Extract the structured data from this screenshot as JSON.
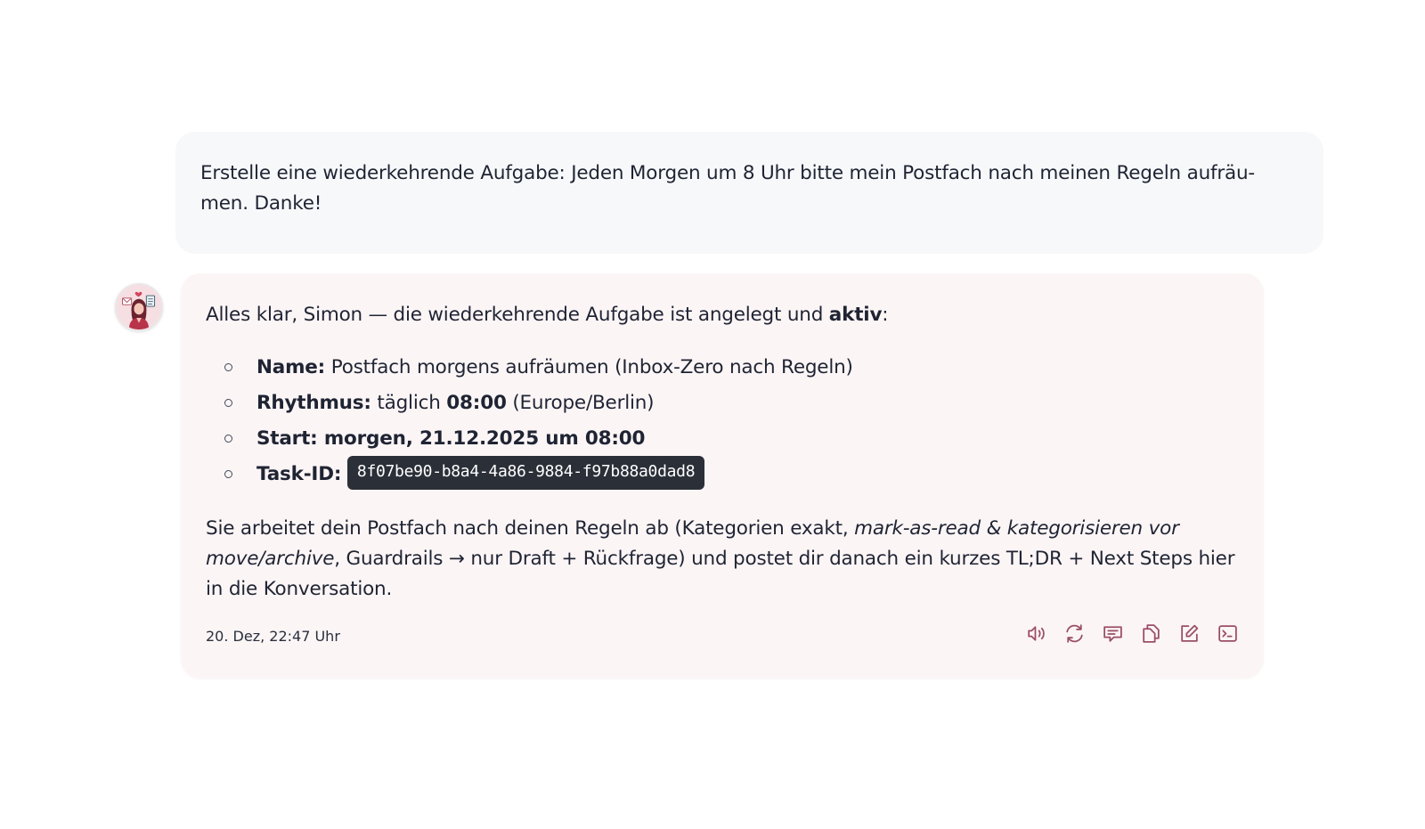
{
  "user_message": {
    "text_line1": "Erstelle eine wiederkehrende Aufgabe: Jeden Morgen um 8 Uhr bitte mein Postfach nach meinen Regeln aufräu-",
    "text_line2": "men. Danke!"
  },
  "assistant_message": {
    "intro_prefix": "Alles klar, Simon — die wiederkehrende Aufgabe ist angelegt und ",
    "intro_bold": "aktiv",
    "intro_suffix": ":",
    "details": {
      "name_label": "Name:",
      "name_value": " Postfach morgens aufräumen (Inbox-Zero nach Regeln)",
      "rhythm_label": "Rhythmus:",
      "rhythm_prefix": " täglich ",
      "rhythm_time": "08:00",
      "rhythm_suffix": " (Europe/Berlin)",
      "start_text": "Start: morgen, 21.12.2025 um 08:00",
      "task_label": "Task-ID:",
      "task_id": "8f07be90-b8a4-4a86-9884-f97b88a0dad8"
    },
    "outro_part1": "Sie arbeitet dein Postfach nach deinen Regeln ab (Kategorien exakt, ",
    "outro_italic1": "mark-as-read & kategorisieren vor",
    "outro_italic2": "move/archive",
    "outro_part2": ", Guardrails → nur Draft + Rückfrage) und postet dir danach ein kurzes TL;DR + Next Steps hier",
    "outro_part3": "in die Konversation.",
    "timestamp": "20. Dez, 22:47 Uhr",
    "actions": [
      {
        "icon": "speaker-icon"
      },
      {
        "icon": "refresh-icon"
      },
      {
        "icon": "comment-icon"
      },
      {
        "icon": "copy-icon"
      },
      {
        "icon": "edit-icon"
      },
      {
        "icon": "terminal-icon"
      }
    ],
    "accent_color": "#9a4e68"
  }
}
